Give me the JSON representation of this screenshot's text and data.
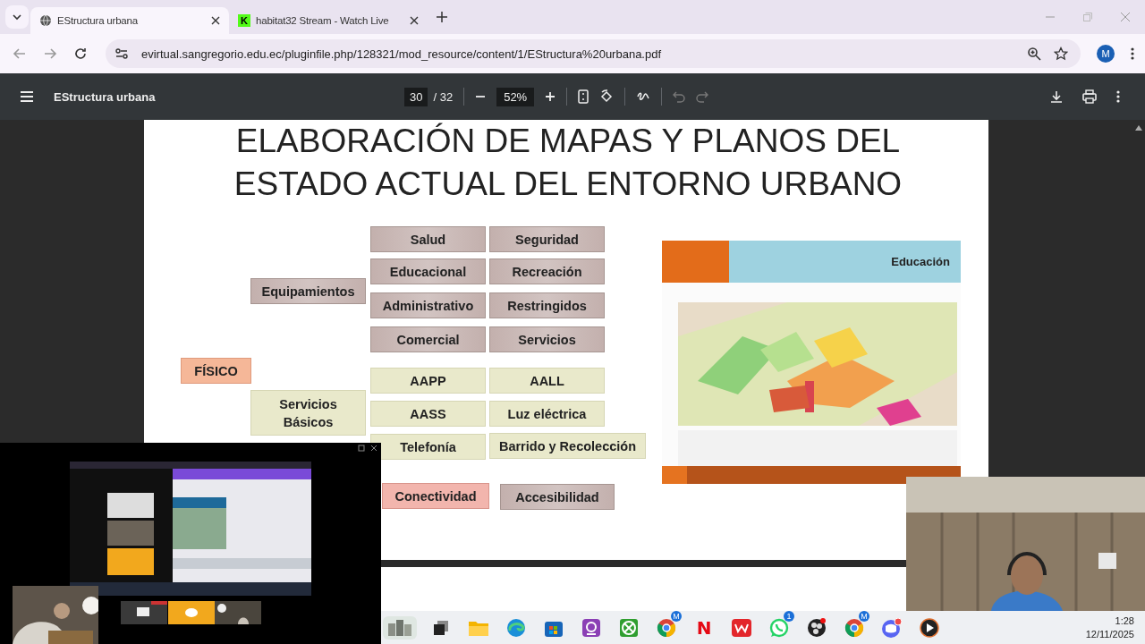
{
  "browser": {
    "tabs": [
      {
        "title": "EStructura urbana",
        "selected": true,
        "kind": "globe"
      },
      {
        "title": "habitat32 Stream - Watch Live",
        "selected": false,
        "kind": "site"
      }
    ],
    "icon_letter": "K",
    "profile": "M",
    "url": "evirtual.sangregorio.edu.ec/pluginfile.php/128321/mod_resource/content/1/EStructura%20urbana.pdf"
  },
  "pdf_toolbar": {
    "title": "EStructura urbana",
    "page": "30",
    "page_total": "/ 32",
    "zoom": "52%"
  },
  "slide": {
    "title_lines": [
      "ELABORACIÓN DE MAPAS Y PLANOS DEL",
      "ESTADO ACTUAL DEL ENTORNO URBANO"
    ],
    "nodes": [
      {
        "label": "Salud",
        "kind": "equip"
      },
      {
        "label": "Seguridad",
        "kind": "equip"
      },
      {
        "label": "Educacional",
        "kind": "equip"
      },
      {
        "label": "Recreación",
        "kind": "equip"
      },
      {
        "label": "Equipamientos",
        "kind": "equip"
      },
      {
        "label": "Administrativo",
        "kind": "equip"
      },
      {
        "label": "Restringidos",
        "kind": "equip"
      },
      {
        "label": "Comercial",
        "kind": "equip"
      },
      {
        "label": "Servicios",
        "kind": "equip"
      },
      {
        "label": "FÍSICO",
        "kind": "root"
      },
      {
        "label": "AAPP",
        "kind": "basic"
      },
      {
        "label": "AALL",
        "kind": "basic"
      },
      {
        "label": "Servicios Básicos",
        "kind": "basic"
      },
      {
        "label": "AASS",
        "kind": "basic"
      },
      {
        "label": "Luz eléctrica",
        "kind": "basic"
      },
      {
        "label": "Telefonía",
        "kind": "basic"
      },
      {
        "label": "Barrido y Recolección",
        "kind": "basic"
      },
      {
        "label": "Conectividad",
        "kind": "link"
      },
      {
        "label": "Accesibilidad",
        "kind": "equip"
      }
    ],
    "map_header": "Educación"
  },
  "taskbar": {
    "items": [
      {
        "kind": "widget"
      },
      {
        "kind": "taskview"
      },
      {
        "kind": "folder"
      },
      {
        "kind": "edge"
      },
      {
        "kind": "store"
      },
      {
        "kind": "camera"
      },
      {
        "kind": "xbox"
      },
      {
        "kind": "chrome",
        "badge": "M"
      },
      {
        "kind": "netflix",
        "label": "N"
      },
      {
        "kind": "wps"
      },
      {
        "kind": "whatsapp",
        "badge": "1"
      },
      {
        "kind": "obs"
      },
      {
        "kind": "chrome",
        "badge": "M"
      },
      {
        "kind": "discord"
      },
      {
        "kind": "player"
      }
    ],
    "time": "1:28",
    "date": "12/11/2025"
  }
}
